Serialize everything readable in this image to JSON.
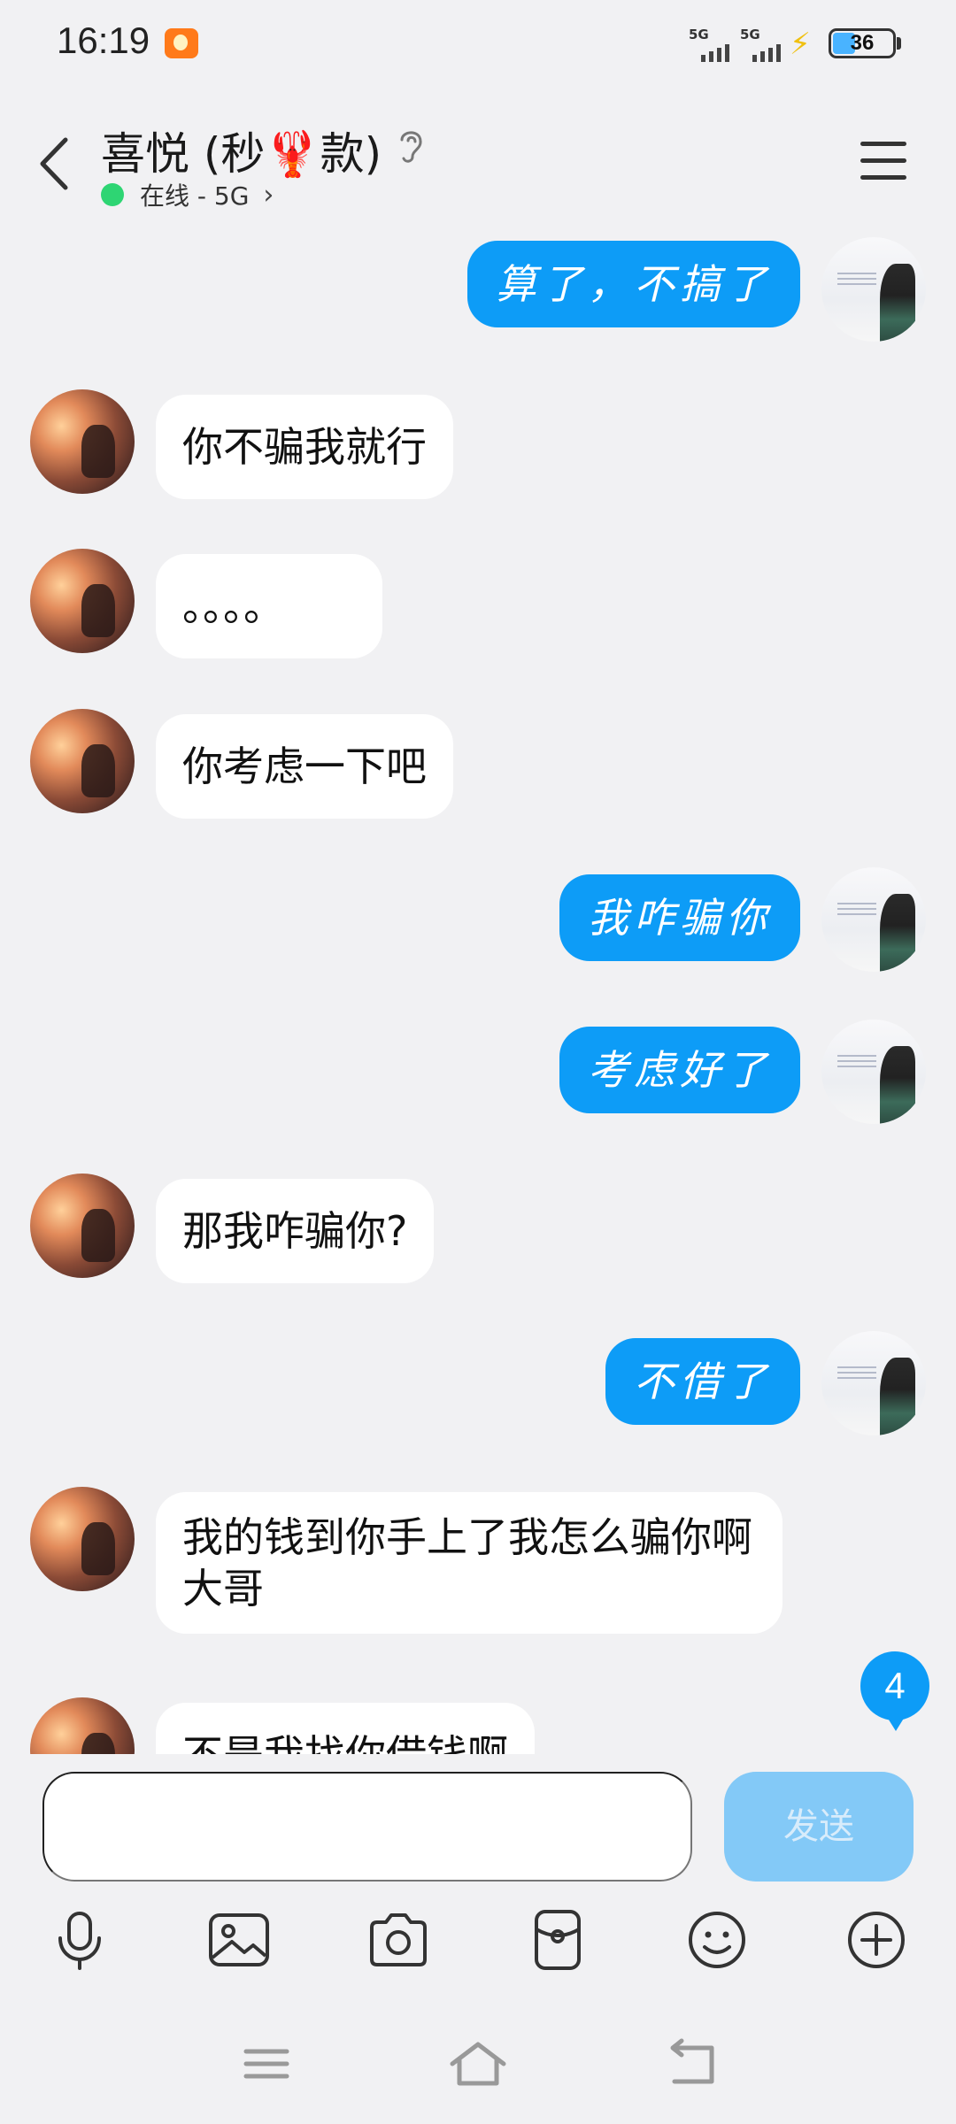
{
  "status_bar": {
    "time": "16:19",
    "signal1_label": "5G",
    "signal2_label": "5G",
    "battery": "36",
    "battery_level": 0.36,
    "icons": [
      "app-notification-icon",
      "signal-icon",
      "signal-icon",
      "charging-icon",
      "battery-icon"
    ]
  },
  "header": {
    "title": "喜悦 (秒🦞款)",
    "status_text": "在线 - 5G",
    "status_color": "#2ed573",
    "icons": [
      "back-icon",
      "ear-icon",
      "chevron-right-icon",
      "menu-icon"
    ]
  },
  "messages": [
    {
      "sender": "me",
      "text": "算了，不搞了"
    },
    {
      "sender": "peer",
      "text": "你不骗我就行"
    },
    {
      "sender": "peer",
      "text": "。。。。"
    },
    {
      "sender": "peer",
      "text": "你考虑一下吧"
    },
    {
      "sender": "me",
      "text": "我咋骗你"
    },
    {
      "sender": "me",
      "text": "考虑好了"
    },
    {
      "sender": "peer",
      "text": "那我咋骗你?"
    },
    {
      "sender": "me",
      "text": "不借了"
    },
    {
      "sender": "peer",
      "text": "我的钱到你手上了我怎么骗你啊大哥"
    },
    {
      "sender": "peer",
      "text": "不是我找你借钱啊"
    }
  ],
  "unread_badge": "4",
  "input": {
    "placeholder": "",
    "send_label": "发送"
  },
  "toolbar": {
    "icons": [
      "microphone-icon",
      "image-icon",
      "camera-icon",
      "red-packet-icon",
      "emoji-icon",
      "plus-icon"
    ]
  },
  "navbar": {
    "icons": [
      "recent-apps-icon",
      "home-icon",
      "back-nav-icon"
    ]
  },
  "colors": {
    "accent": "#0d9cf7",
    "send_disabled": "#83c9f7",
    "background": "#f1f1f3",
    "peer_bubble": "#ffffff"
  }
}
